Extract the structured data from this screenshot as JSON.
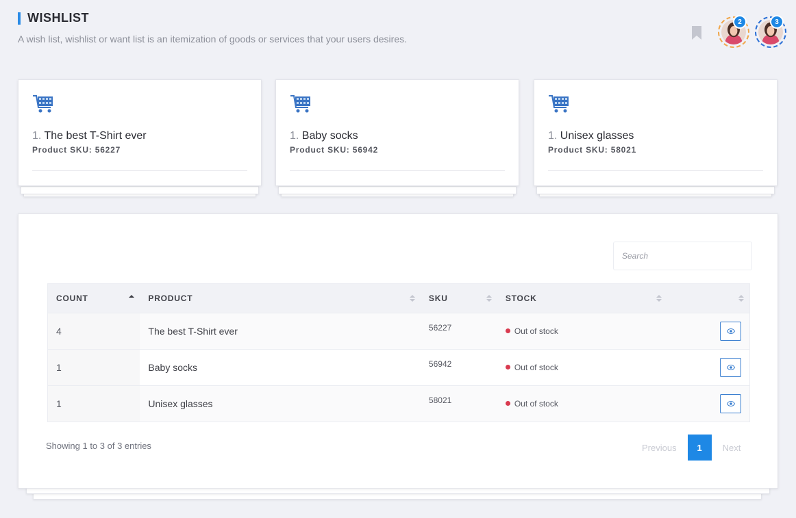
{
  "header": {
    "title": "WISHLIST",
    "subtitle": "A wish list, wishlist or want list is an itemization of goods or services that your users desires.",
    "avatars": [
      {
        "badge": "2",
        "ring_color": "#f0a64a"
      },
      {
        "badge": "3",
        "ring_color": "#2a6fd6"
      }
    ]
  },
  "cards": [
    {
      "num": "1.",
      "name": "The best T-Shirt ever",
      "sku_label": "Product SKU: 56227"
    },
    {
      "num": "1.",
      "name": "Baby socks",
      "sku_label": "Product SKU: 56942"
    },
    {
      "num": "1.",
      "name": "Unisex glasses",
      "sku_label": "Product SKU: 58021"
    }
  ],
  "search": {
    "placeholder": "Search"
  },
  "table": {
    "columns": [
      "COUNT",
      "PRODUCT",
      "SKU",
      "STOCK",
      ""
    ],
    "rows": [
      {
        "count": "4",
        "product": "The best T-Shirt ever",
        "sku": "56227",
        "stock": "Out of stock"
      },
      {
        "count": "1",
        "product": "Baby socks",
        "sku": "56942",
        "stock": "Out of stock"
      },
      {
        "count": "1",
        "product": "Unisex glasses",
        "sku": "58021",
        "stock": "Out of stock"
      }
    ]
  },
  "footer": {
    "info": "Showing 1 to 3 of 3 entries",
    "previous": "Previous",
    "current_page": "1",
    "next": "Next"
  },
  "colors": {
    "accent": "#1e88e5",
    "out_of_stock": "#d93a4f",
    "background": "#f0f1f6"
  },
  "icons": [
    "bookmark-icon",
    "cart-icon",
    "sort-icon",
    "eye-icon"
  ]
}
